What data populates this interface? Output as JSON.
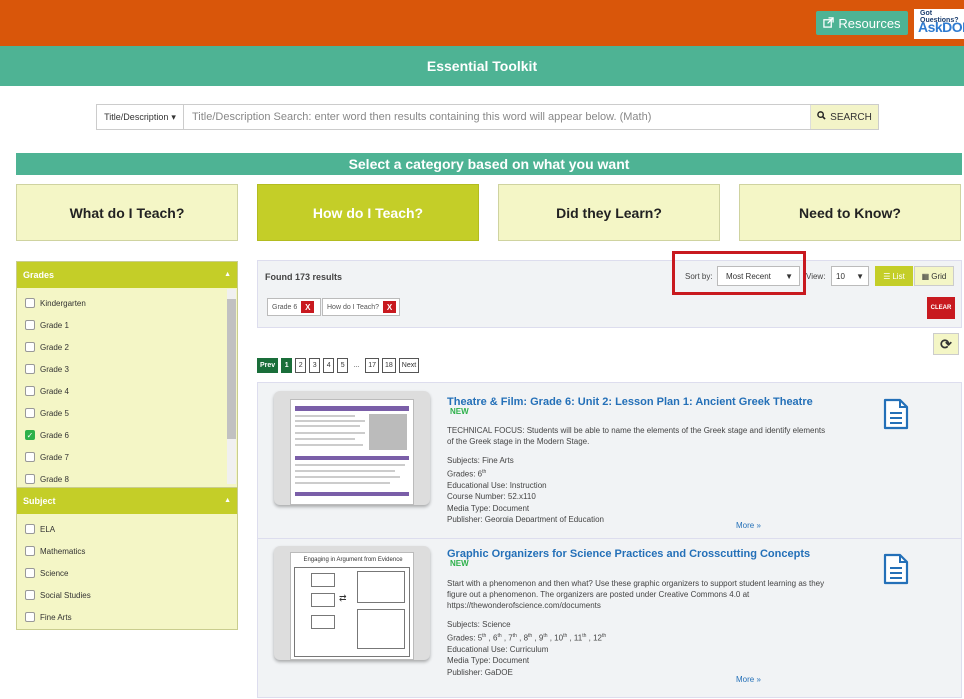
{
  "header": {
    "resources_label": "Resources",
    "ask_small": "Got Questions?",
    "ask_big": "AskDOE",
    "title": "Essential Toolkit"
  },
  "search": {
    "field_select": "Title/Description",
    "placeholder": "Title/Description Search:  enter word then results containing this word will appear below. (Math)",
    "button_label": "SEARCH"
  },
  "categories": {
    "heading": "Select a category based on what you want",
    "items": [
      {
        "label": "What do I Teach?",
        "active": false
      },
      {
        "label": "How do I Teach?",
        "active": true
      },
      {
        "label": "Did they Learn?",
        "active": false
      },
      {
        "label": "Need to Know?",
        "active": false
      }
    ]
  },
  "filters": {
    "grades": {
      "title": "Grades",
      "options": [
        {
          "label": "Kindergarten",
          "checked": false
        },
        {
          "label": "Grade 1",
          "checked": false
        },
        {
          "label": "Grade 2",
          "checked": false
        },
        {
          "label": "Grade 3",
          "checked": false
        },
        {
          "label": "Grade 4",
          "checked": false
        },
        {
          "label": "Grade 5",
          "checked": false
        },
        {
          "label": "Grade 6",
          "checked": true
        },
        {
          "label": "Grade 7",
          "checked": false
        },
        {
          "label": "Grade 8",
          "checked": false
        }
      ]
    },
    "subject": {
      "title": "Subject",
      "options": [
        {
          "label": "ELA",
          "checked": false
        },
        {
          "label": "Mathematics",
          "checked": false
        },
        {
          "label": "Science",
          "checked": false
        },
        {
          "label": "Social Studies",
          "checked": false
        },
        {
          "label": "Fine Arts",
          "checked": false
        }
      ]
    }
  },
  "results": {
    "found_text": "Found 173 results",
    "sort_label": "Sort by:",
    "sort_value": "Most Recent",
    "view_label": "View:",
    "view_count": "10",
    "list_label": "List",
    "grid_label": "Grid",
    "active_tags": [
      "Grade 6",
      "How do I Teach?"
    ],
    "tag_remove": "X",
    "clear_label": "CLEAR"
  },
  "pagination": {
    "prev": "Prev",
    "pages": [
      "1",
      "2",
      "3",
      "4",
      "5"
    ],
    "ellipsis": "...",
    "last_pages": [
      "17",
      "18"
    ],
    "next": "Next"
  },
  "items": [
    {
      "title": "Theatre & Film: Grade 6: Unit 2: Lesson Plan 1: Ancient Greek Theatre",
      "new_badge": "NEW",
      "description": "TECHNICAL FOCUS: Students will be able to name the elements of the Greek stage and identify elements of the Greek stage in the Modern Stage.",
      "subjects": "Subjects: Fine Arts",
      "grades_prefix": "Grades: 6",
      "grades_sup": "th",
      "use": "Educational Use: Instruction",
      "course": "Course Number: 52.x110",
      "media": "Media Type: Document",
      "publisher": "Publisher: Georgia Department of Education",
      "more": "More"
    },
    {
      "title": "Graphic Organizers for Science Practices and Crosscutting Concepts",
      "new_badge": "NEW",
      "thumb_caption": "Engaging in Argument from Evidence",
      "description": "Start with a phenomenon and then what? Use these graphic organizers to support student learning as they figure out a phenomenon. The organizers are posted under Creative Commons 4.0 at https://thewonderofscience.com/documents",
      "subjects": "Subjects: Science",
      "grades_prefix": "Grades: ",
      "use": "Educational Use: Curriculum",
      "media": "Media Type: Document",
      "publisher": "Publisher: GaDOE",
      "more": "More"
    }
  ]
}
